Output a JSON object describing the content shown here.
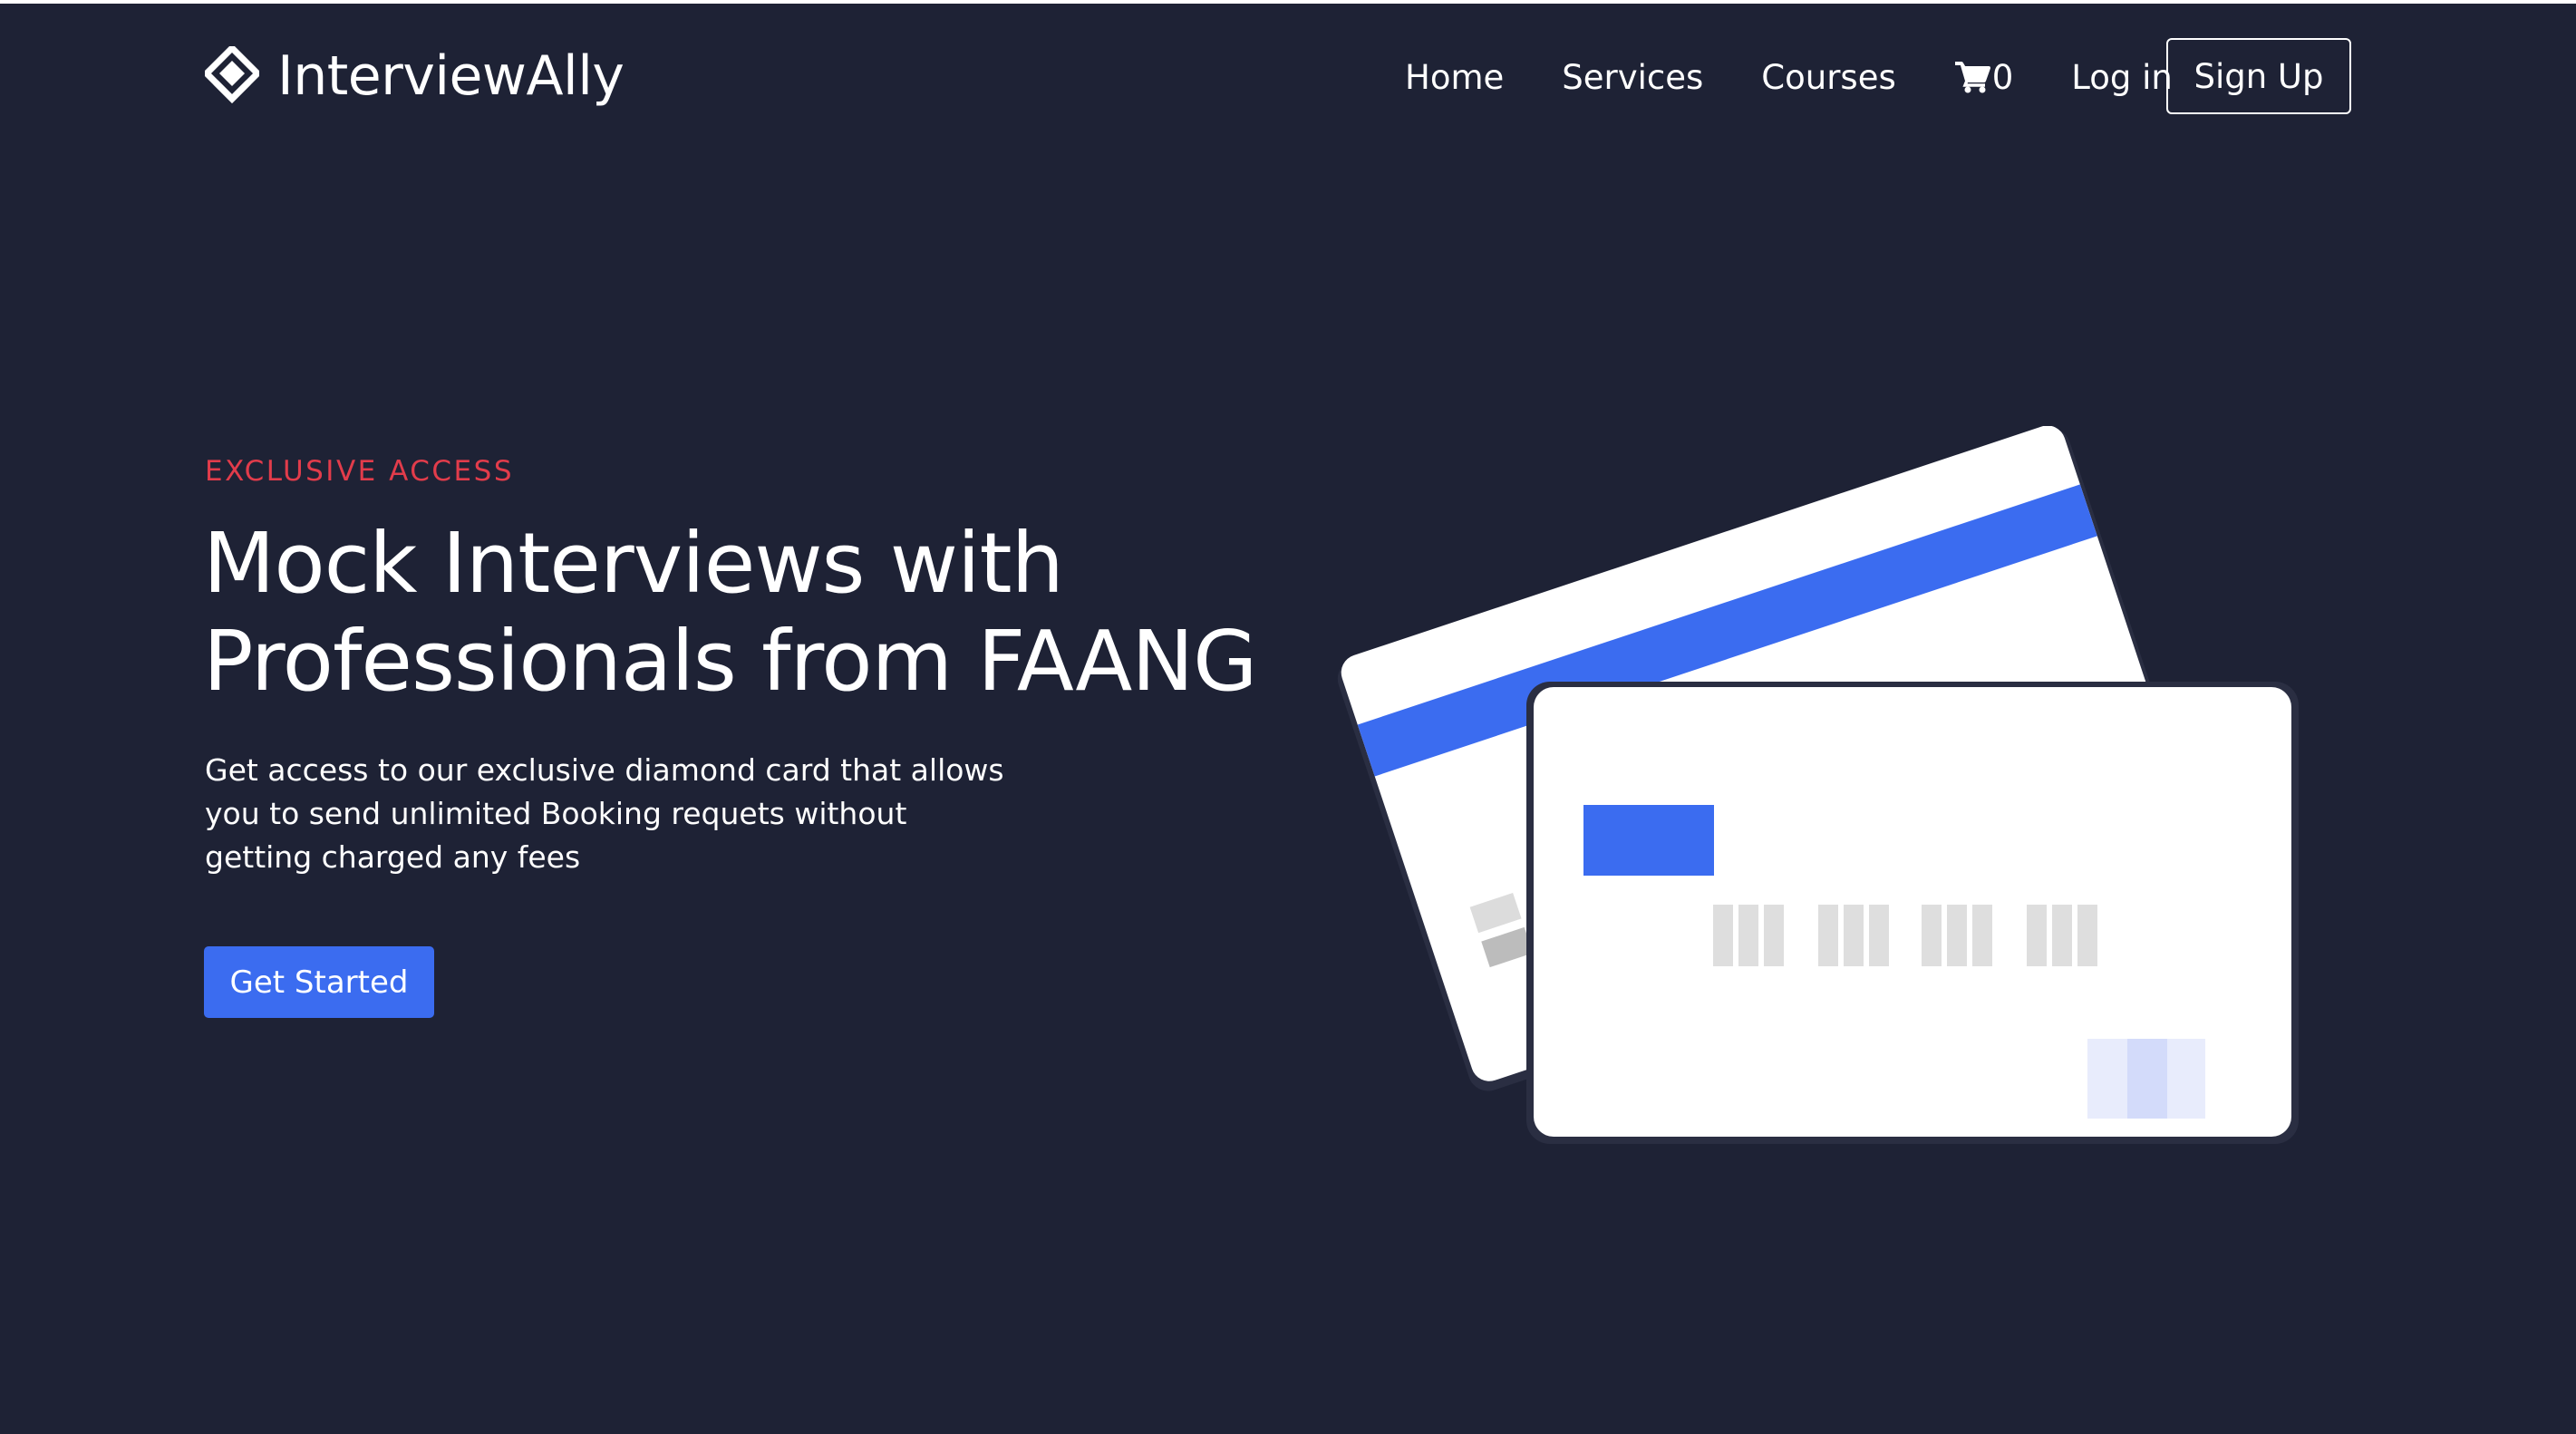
{
  "nav": {
    "brand": "InterviewAlly",
    "links": [
      {
        "label": "Home"
      },
      {
        "label": "Services"
      },
      {
        "label": "Courses"
      }
    ],
    "cart_count": "0",
    "login_label": "Log in",
    "signup_label": "Sign Up"
  },
  "hero": {
    "eyebrow": "EXCLUSIVE ACCESS",
    "title": "Mock Interviews with Professionals from FAANG",
    "description": "Get access to our exclusive diamond card that allows you to send unlimited Booking requets without getting charged any fees",
    "cta_label": "Get Started"
  },
  "colors": {
    "background": "#1e2235",
    "accent_blue": "#3b6cf0",
    "eyebrow_red": "#e23c4b",
    "card_white": "#ffffff"
  },
  "icons": {
    "logo": "stacked-diamond-logo-icon",
    "cart": "shopping-cart-icon"
  }
}
